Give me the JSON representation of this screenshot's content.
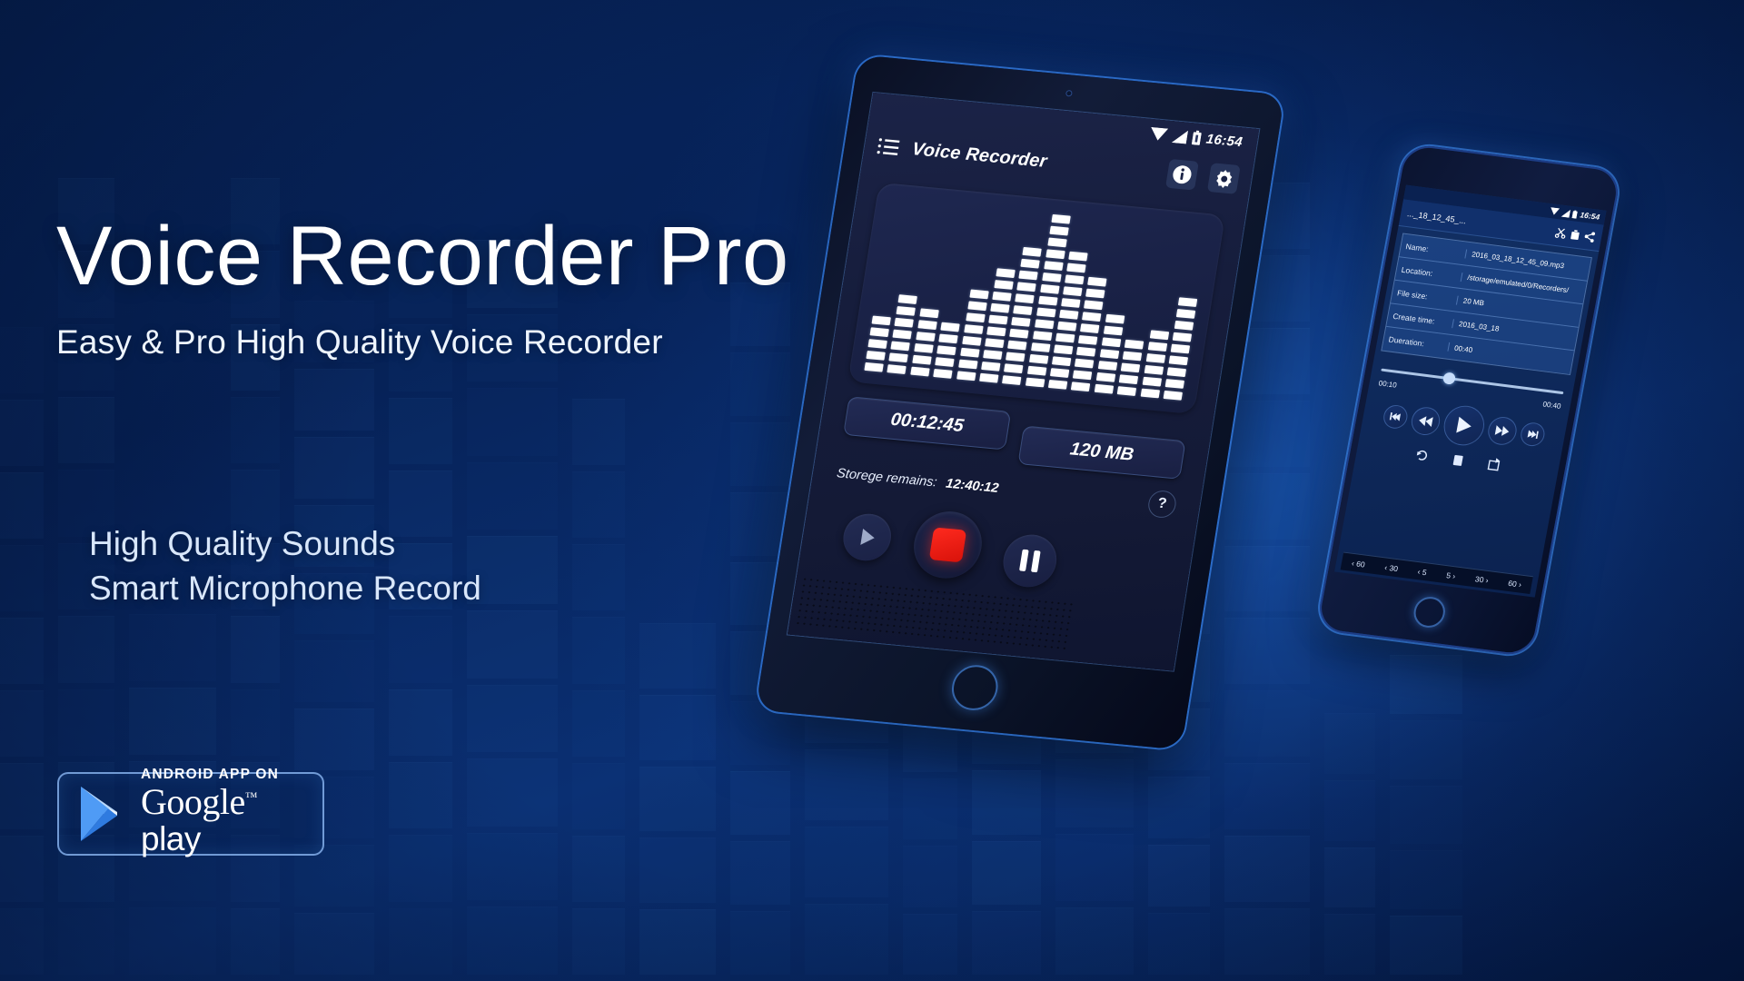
{
  "page": {
    "title": "Voice Recorder Pro",
    "subtitle": "Easy & Pro  High Quality Voice Recorder",
    "features": [
      "High Quality Sounds",
      "Smart Microphone Record"
    ]
  },
  "store_badge": {
    "name": "google-play-badge",
    "small_text": "ANDROID APP ON",
    "brand": "Google",
    "trademark": "™",
    "product": "play"
  },
  "colors": {
    "background_deep": "#062055",
    "background_mid": "#0a2f72",
    "accent_blue": "#3c8cfa",
    "record_red": "#ff2a1f",
    "text_primary": "#ffffff",
    "text_secondary": "#d9e7fb"
  },
  "tablet": {
    "status_bar": {
      "time": "16:54",
      "icons": [
        "wifi-icon",
        "signal-icon",
        "battery-icon"
      ]
    },
    "app_bar": {
      "menu_icon": "list-icon",
      "title": "Voice Recorder",
      "info_icon": "info-icon",
      "settings_icon": "gear-icon"
    },
    "visualizer": {
      "name": "audio-equalizer",
      "columns": [
        5,
        7,
        6,
        5,
        8,
        10,
        12,
        15,
        12,
        10,
        7,
        5,
        6,
        9
      ]
    },
    "readouts": {
      "elapsed": "00:12:45",
      "file_size": "120 MB",
      "storage_label": "Storege remains:",
      "storage_value": "12:40:12",
      "help_label": "?"
    },
    "controls": [
      {
        "name": "play-button",
        "icon": "play-icon"
      },
      {
        "name": "record-button",
        "icon": "record-icon"
      },
      {
        "name": "pause-button",
        "icon": "pause-icon"
      }
    ]
  },
  "phone": {
    "status_bar": {
      "time": "16:54",
      "icons": [
        "wifi-icon",
        "signal-icon",
        "battery-icon"
      ]
    },
    "app_bar": {
      "filename": "..._18_12_45_...",
      "icons": [
        "cut-icon",
        "delete-icon",
        "share-icon"
      ]
    },
    "details": [
      {
        "key": "Name:",
        "value": "2016_03_18_12_45_09.mp3"
      },
      {
        "key": "Location:",
        "value": "/storage/emulated/0/Recorders/"
      },
      {
        "key": "File size:",
        "value": "20 MB"
      },
      {
        "key": "Create time:",
        "value": "2016_03_18"
      },
      {
        "key": "Dueration:",
        "value": "00:40"
      }
    ],
    "player": {
      "position": "00:10",
      "duration": "00:40",
      "progress_percent": 34,
      "transport": [
        {
          "name": "previous-button",
          "icon": "skip-previous-icon"
        },
        {
          "name": "rewind-button",
          "icon": "rewind-icon"
        },
        {
          "name": "play-button",
          "icon": "play-icon"
        },
        {
          "name": "forward-button",
          "icon": "fast-forward-icon"
        },
        {
          "name": "next-button",
          "icon": "skip-next-icon"
        }
      ],
      "secondary": [
        {
          "name": "loop-button",
          "icon": "loop-icon"
        },
        {
          "name": "stop-button",
          "icon": "stop-icon"
        },
        {
          "name": "repeat-button",
          "icon": "repeat-icon"
        }
      ],
      "jump_buttons": [
        "‹ 60",
        "‹ 30",
        "‹ 5",
        "5 ›",
        "30 ›",
        "60 ›"
      ]
    }
  }
}
